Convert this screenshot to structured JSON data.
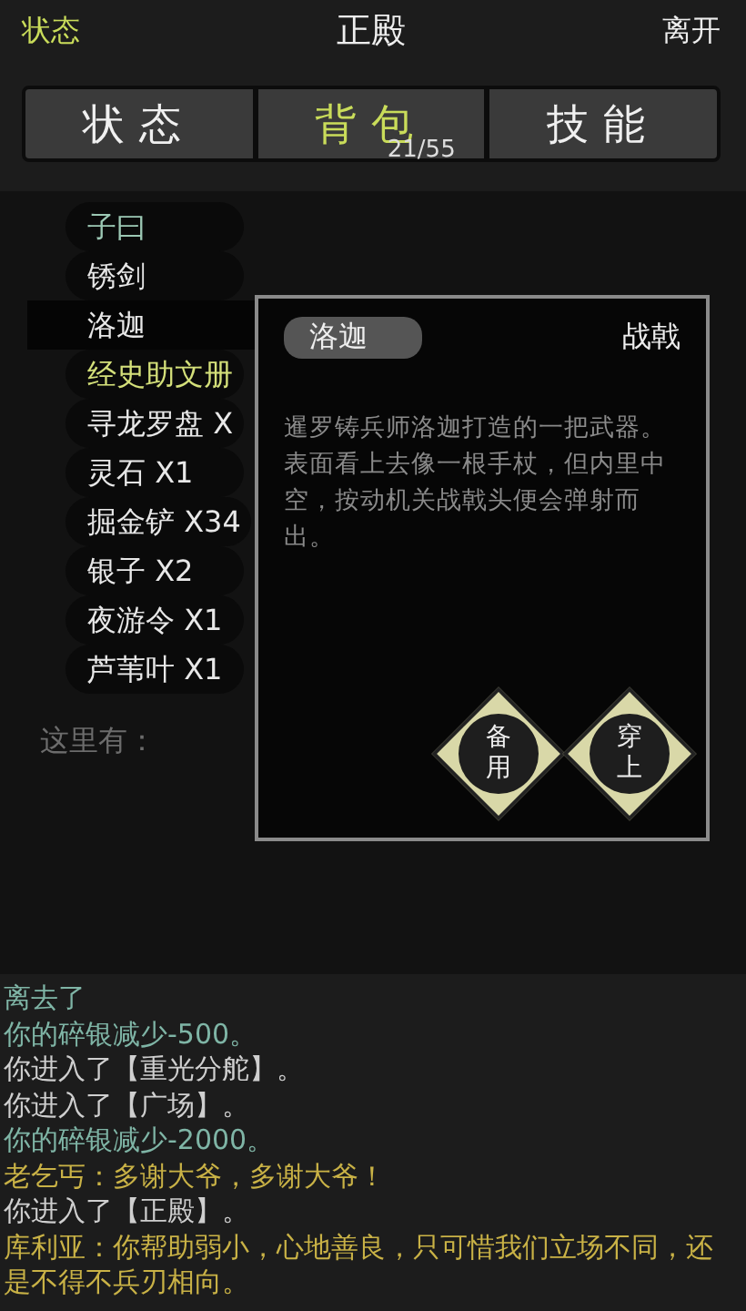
{
  "header": {
    "left": "状态",
    "title": "正殿",
    "right": "离开"
  },
  "tabs": [
    {
      "label": "状态",
      "selected": false
    },
    {
      "label": "背包",
      "selected": true,
      "count": "21/55"
    },
    {
      "label": "技能",
      "selected": false
    }
  ],
  "items": [
    {
      "name": "子曰",
      "color": "#9cc8b4",
      "selected": false
    },
    {
      "name": "锈剑",
      "color": "#e8e8e8",
      "selected": false
    },
    {
      "name": "洛迦",
      "color": "#e8e8e8",
      "selected": true
    },
    {
      "name": "经史助文册",
      "color": "#d4e07a",
      "selected": false
    },
    {
      "name": "寻龙罗盘 X",
      "color": "#e8e8e8",
      "selected": false
    },
    {
      "name": "灵石 X1",
      "color": "#e8e8e8",
      "selected": false
    },
    {
      "name": "掘金铲 X34",
      "color": "#e8e8e8",
      "selected": false
    },
    {
      "name": "银子 X2",
      "color": "#e8e8e8",
      "selected": false
    },
    {
      "name": "夜游令 X1",
      "color": "#e8e8e8",
      "selected": false
    },
    {
      "name": "芦苇叶 X1",
      "color": "#e8e8e8",
      "selected": false
    }
  ],
  "here_label": "这里有：",
  "popup": {
    "name": "洛迦",
    "type": "战戟",
    "description": "暹罗铸兵师洛迦打造的一把武器。表面看上去像一根手杖，但内里中空，按动机关战戟头便会弹射而出。",
    "buttons": [
      "备用",
      "穿上"
    ]
  },
  "log": [
    {
      "kind": "system",
      "text": "离去了"
    },
    {
      "kind": "system",
      "text": "你的碎银减少-500。"
    },
    {
      "kind": "move",
      "text": "你进入了【重光分舵】。"
    },
    {
      "kind": "move",
      "text": "你进入了【广场】。"
    },
    {
      "kind": "system",
      "text": "你的碎银减少-2000。"
    },
    {
      "kind": "npc",
      "text": "老乞丐：多谢大爷，多谢大爷！"
    },
    {
      "kind": "move",
      "text": "你进入了【正殿】。"
    },
    {
      "kind": "npc",
      "text": "库利亚：你帮助弱小，心地善良，只可惜我们立场不同，还是不得不兵刃相向。"
    }
  ]
}
